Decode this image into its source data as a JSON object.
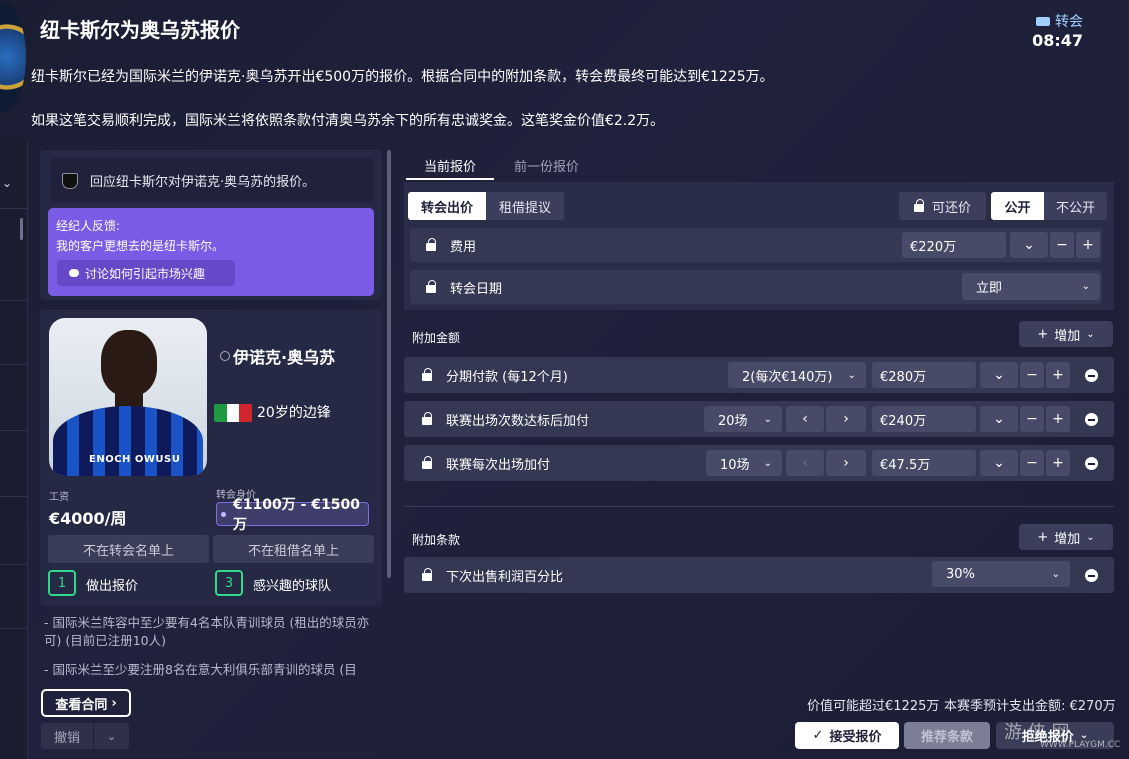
{
  "header": {
    "title": "纽卡斯尔为奥乌苏报价",
    "window_tag": "转会",
    "clock": "08:47"
  },
  "description": {
    "line1": "纽卡斯尔已经为国际米兰的伊诺克·奥乌苏开出€500万的报价。根据合同中的附加条款，转会费最终可能达到€1225万。",
    "line2": "如果这笔交易顺利完成，国际米兰将依照条款付清奥乌苏余下的所有忠诚奖金。这笔奖金价值€2.2万。"
  },
  "respond": {
    "heading": "回应纽卡斯尔对伊诺克·奥乌苏的报价。",
    "agent_label": "经纪人反馈:",
    "agent_text": "我的客户更想去的是纽卡斯尔。",
    "agent_button": "讨论如何引起市场兴趣"
  },
  "player": {
    "photo_name": "ENOCH OWUSU",
    "name": "伊诺克·奥乌苏",
    "role": "20岁的边锋",
    "wage_label": "工资",
    "wage": "€4000/周",
    "value_label": "转会身价",
    "value": "€1100万 - €1500万",
    "transfer_list": "不在转会名单上",
    "loan_list": "不在租借名单上",
    "offers_count": "1",
    "offers_label": "做出报价",
    "clubs_count": "3",
    "clubs_label": "感兴趣的球队",
    "flag_colors": [
      "#1f9a43",
      "#ffffff",
      "#d2262f"
    ]
  },
  "notes": {
    "note1": "- 国际米兰阵容中至少要有4名本队青训球员 (租出的球员亦可) (目前已注册10人)",
    "note2": "- 国际米兰至少要注册8名在意大利俱乐部青训的球员 (目"
  },
  "bottom_left": {
    "contract_button": "查看合同",
    "cancel_button": "撤销"
  },
  "tabs": {
    "current": "当前报价",
    "previous": "前一份报价"
  },
  "offer": {
    "type_transfer": "转会出价",
    "type_loan": "租借提议",
    "negotiable": "可还价",
    "public": "公开",
    "private": "不公开",
    "fee_label": "费用",
    "fee_value": "€220万",
    "date_label": "转会日期",
    "date_value": "立即"
  },
  "addons": {
    "section": "附加金额",
    "add_label": "增加",
    "rows": [
      {
        "label": "分期付款 (每12个月)",
        "selector": "2(每次€140万)",
        "amount": "€280万"
      },
      {
        "label": "联赛出场次数达标后加付",
        "selector": "20场",
        "amount": "€240万"
      },
      {
        "label": "联赛每次出场加付",
        "selector": "10场",
        "amount": "€47.5万"
      }
    ]
  },
  "clauses": {
    "section": "附加条款",
    "add_label": "增加",
    "sell_on_label": "下次出售利润百分比",
    "sell_on_value": "30%"
  },
  "footer": {
    "max_value": "价值可能超过€1225万",
    "season_cost": "本赛季预计支出金额: €270万",
    "accept": "接受报价",
    "recommend": "推荐条款",
    "reject": "拒绝报价",
    "watermark": "游 侠 网",
    "watermark_url": "WWW.PLAYGM.CC"
  }
}
